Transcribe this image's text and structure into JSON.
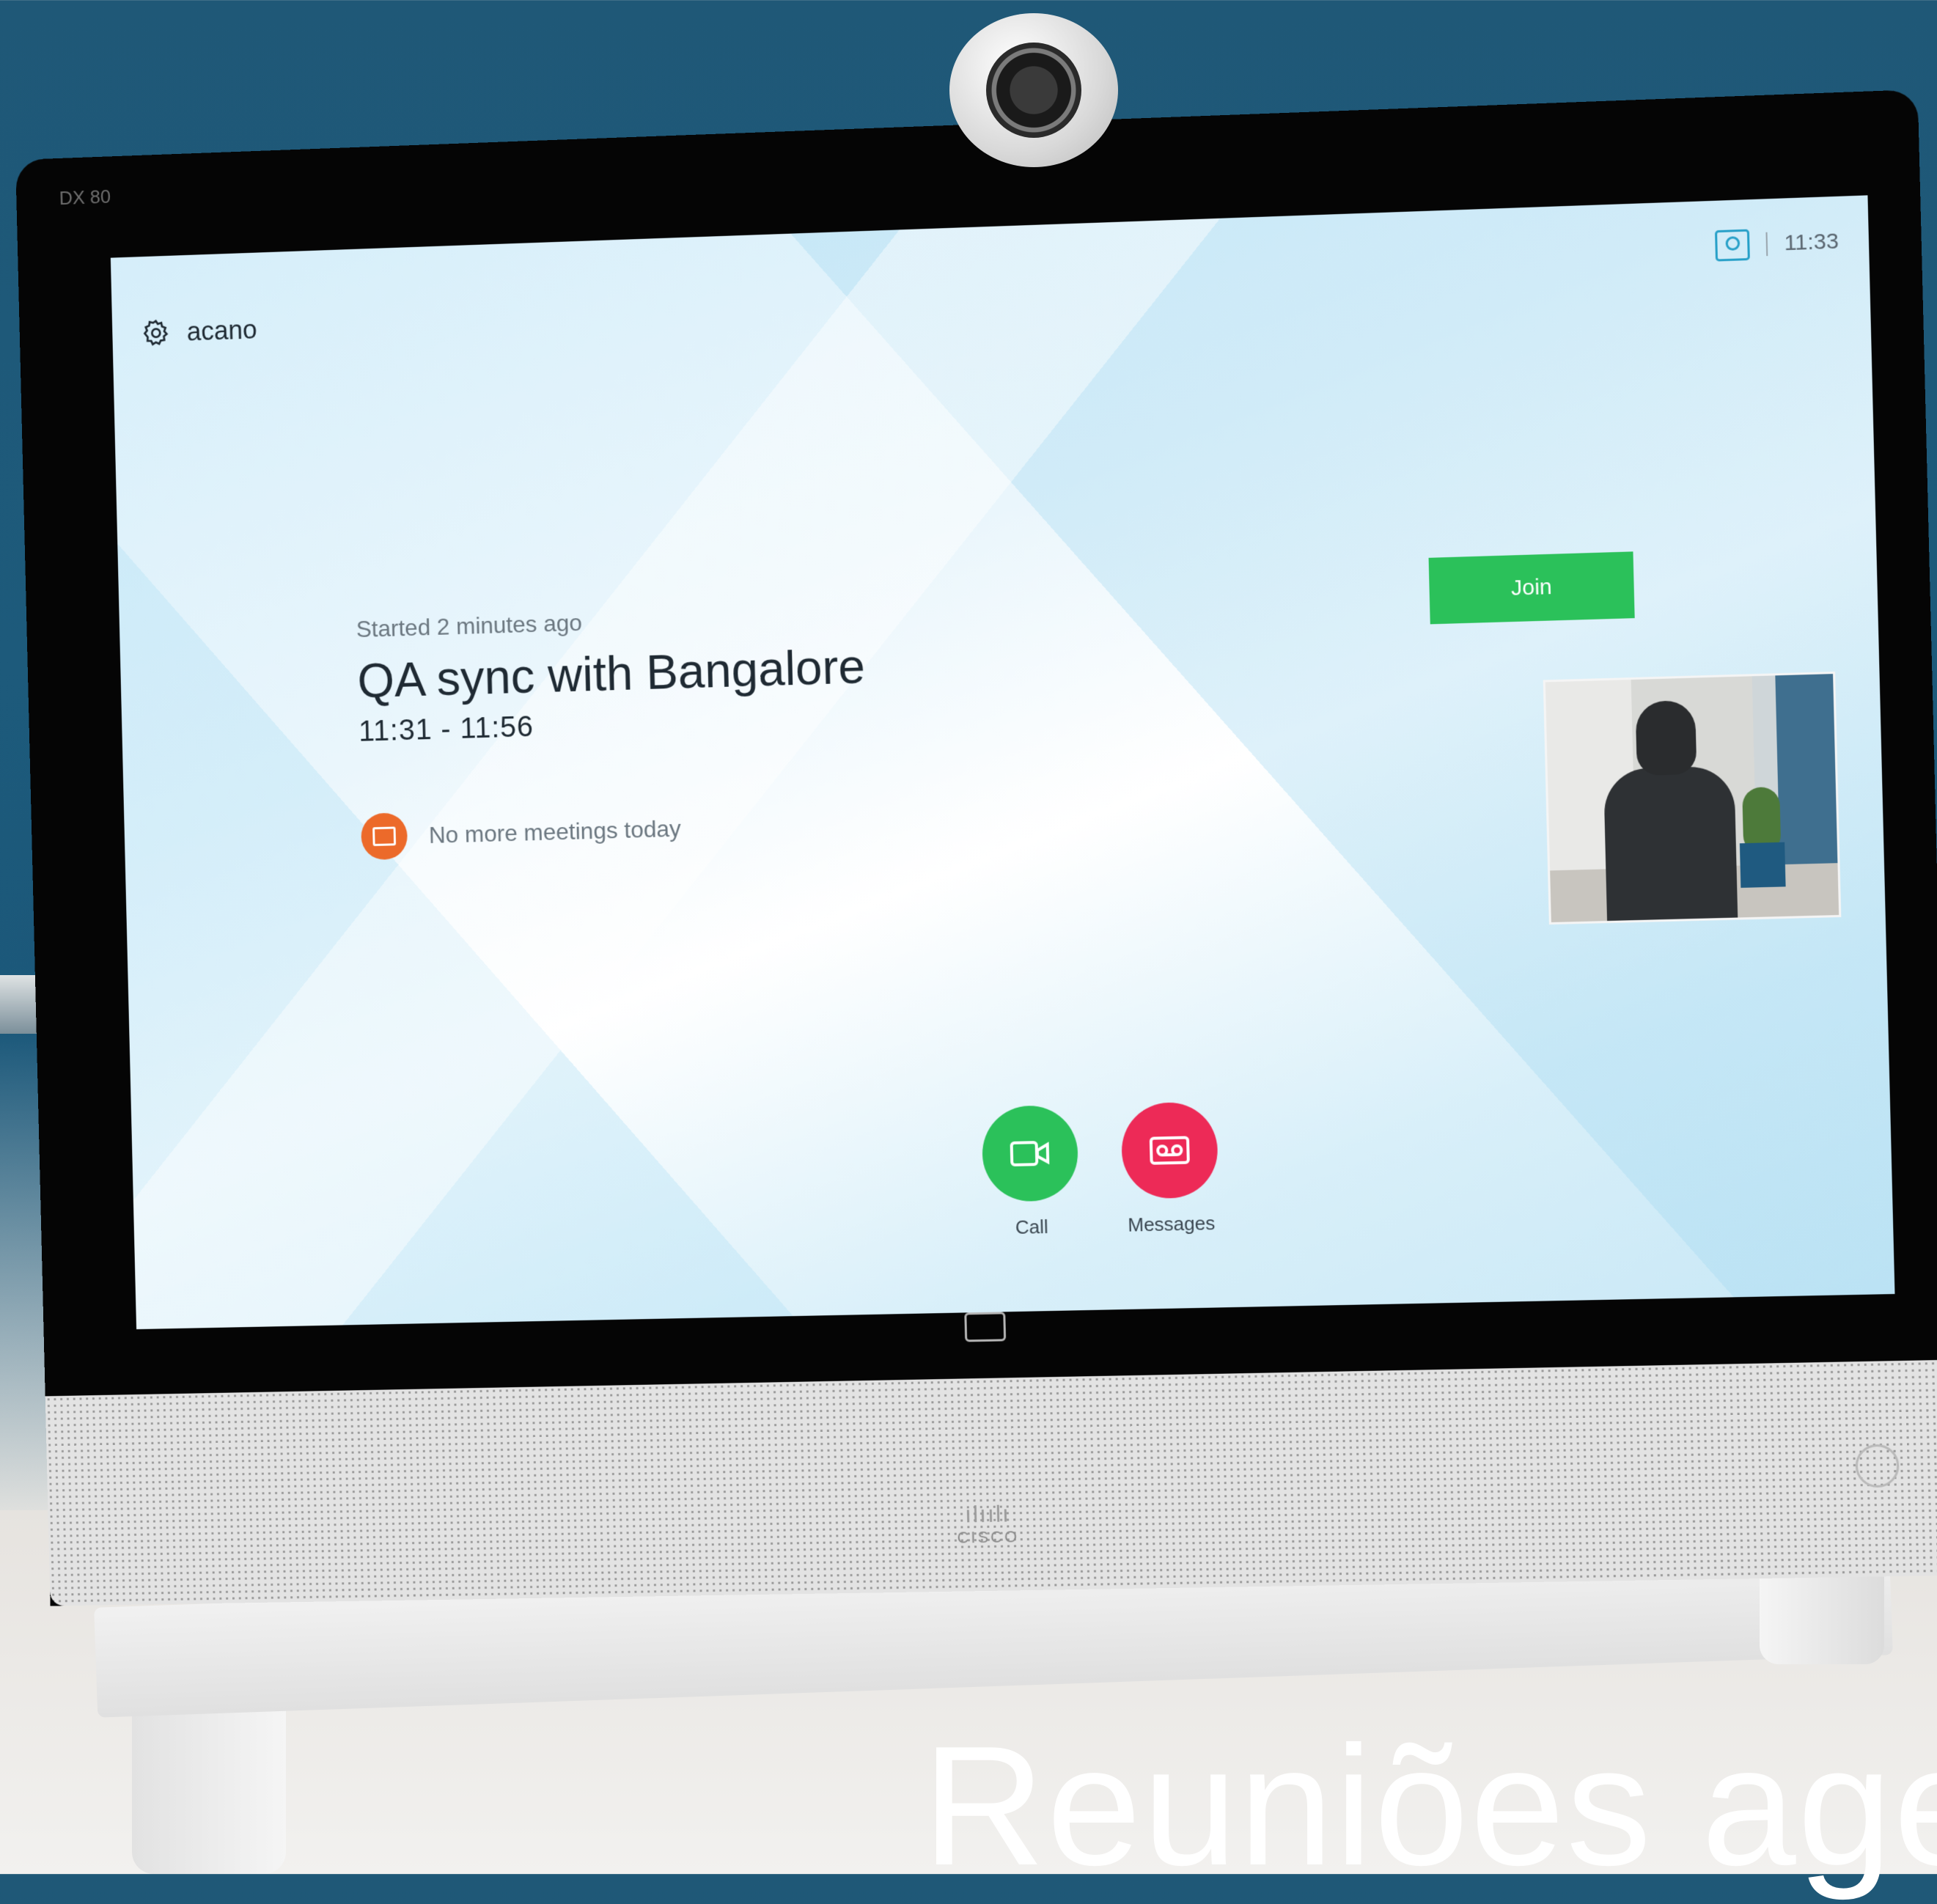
{
  "device": {
    "model": "DX 80"
  },
  "statusbar": {
    "user": "acano",
    "clock": "11:33",
    "selfview_icon": "selfview-icon",
    "settings_icon": "gear-icon"
  },
  "meeting": {
    "started": "Started 2 minutes ago",
    "title": "QA sync with Bangalore",
    "time": "11:31 - 11:56",
    "join_label": "Join",
    "no_more": "No more meetings today"
  },
  "dock": {
    "call_label": "Call",
    "messages_label": "Messages"
  },
  "branding": {
    "cisco": "CISCO",
    "cisco_bars": "ılıılı"
  },
  "overlay": {
    "text": "Reuniões age"
  },
  "colors": {
    "join": "#2bc15a",
    "call": "#2bc15a",
    "messages": "#ed2a57",
    "notice": "#ec6a2a",
    "selfview_accent": "#27a0c8"
  }
}
